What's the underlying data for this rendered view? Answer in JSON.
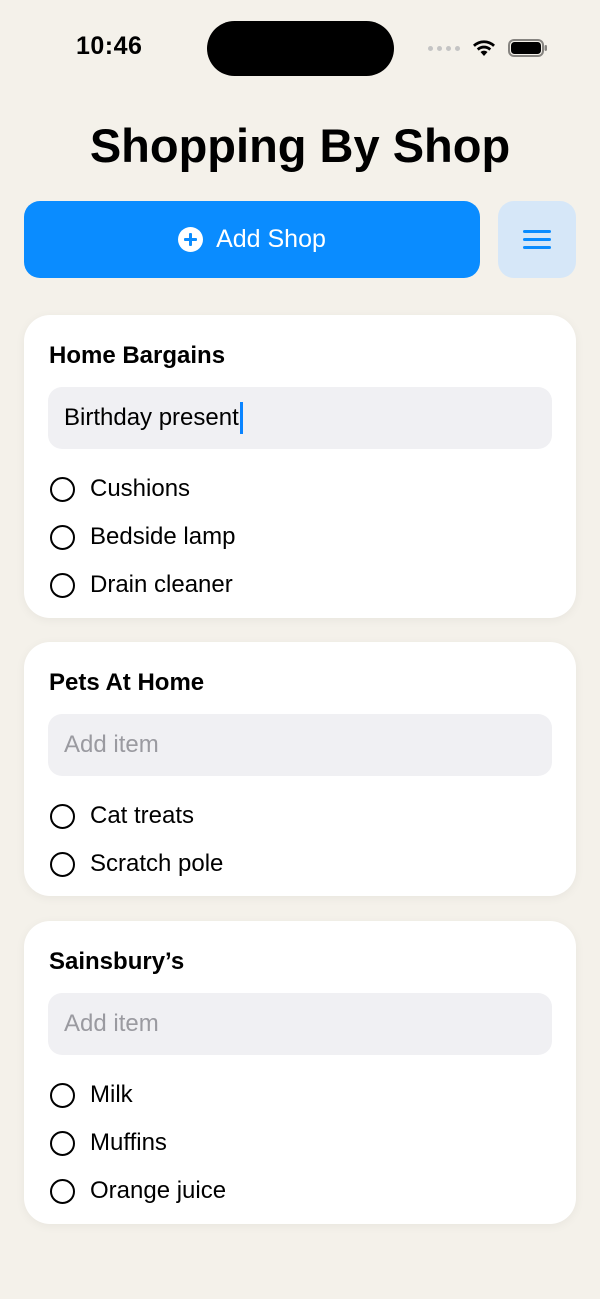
{
  "status": {
    "time": "10:46"
  },
  "header": {
    "title": "Shopping By Shop"
  },
  "actions": {
    "add_shop_label": "Add Shop",
    "add_shop_icon": "plus-circle-icon",
    "menu_icon": "menu-lines-icon",
    "accent_color": "#0a8cff"
  },
  "shops": [
    {
      "name": "Home Bargains",
      "input_value": "Birthday present",
      "input_placeholder": "Add item",
      "items": [
        "Cushions",
        "Bedside lamp",
        "Drain cleaner"
      ]
    },
    {
      "name": "Pets At Home",
      "input_value": "",
      "input_placeholder": "Add item",
      "items": [
        "Cat treats",
        "Scratch pole"
      ]
    },
    {
      "name": "Sainsbury’s",
      "input_value": "",
      "input_placeholder": "Add item",
      "items": [
        "Milk",
        "Muffins",
        "Orange juice"
      ]
    }
  ]
}
